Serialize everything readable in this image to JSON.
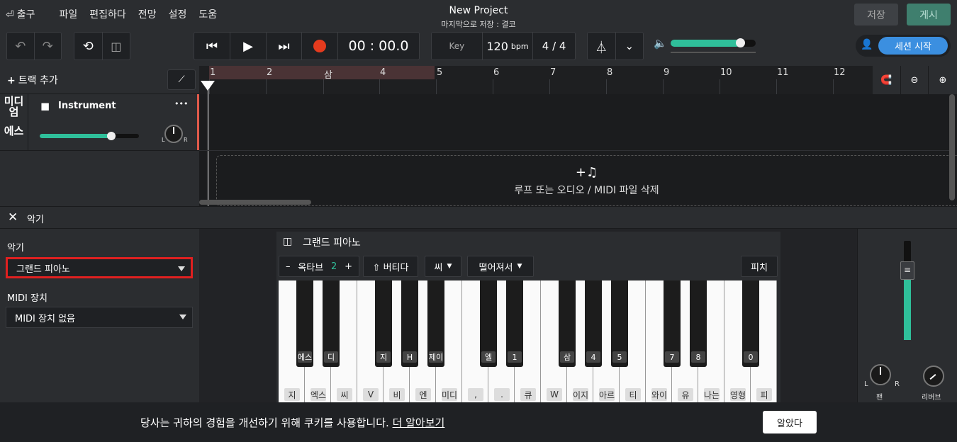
{
  "menu": {
    "exit": "출구",
    "items": [
      "파일",
      "편집하다",
      "전망",
      "설정",
      "도움"
    ]
  },
  "project": {
    "title": "New Project",
    "last_saved": "마지막으로 저장 : 결코"
  },
  "header": {
    "save": "저장",
    "publish": "게시"
  },
  "transport": {
    "time": "00 : 00.0",
    "key": "Key",
    "bpm_value": "120",
    "bpm_unit": "bpm",
    "signature": "4 / 4",
    "volume": 0.82
  },
  "session": {
    "start": "세션 시작"
  },
  "tracks": {
    "add": "트랙 추가",
    "items": [
      {
        "type_line1": "미디",
        "type_line2": "엄",
        "type_line3": "에스",
        "name": "Instrument",
        "more": "•••",
        "volume": 0.72,
        "pan_l": "L",
        "pan_r": "R"
      }
    ]
  },
  "ruler": {
    "marks": [
      "1",
      "2",
      "삼",
      "4",
      "5",
      "6",
      "7",
      "8",
      "9",
      "10",
      "11",
      "12"
    ]
  },
  "dropzone": {
    "icon": "+♫",
    "text": "루프 또는 오디오 / MIDI 파일 삭제"
  },
  "instrument_panel": {
    "title": "악기",
    "instrument_label": "악기",
    "instrument_value": "그랜드 피아노",
    "midi_label": "MIDI 장치",
    "midi_value": "MIDI 장치 없음"
  },
  "piano": {
    "title": "그랜드 피아노",
    "octave_minus": "–",
    "octave_label": "옥타브",
    "octave_value": "2",
    "octave_plus": "+",
    "sustain": "⇧ 버티다",
    "velocity": "씨",
    "sound": "떨어져서",
    "pitch": "피치",
    "black_labels": [
      "에스",
      "디",
      "지",
      "H",
      "제이",
      "엘",
      "1",
      "삼",
      "4",
      "5",
      "7",
      "8",
      "0"
    ],
    "white_labels": [
      "지",
      "엑스",
      "씨",
      "V",
      "비",
      "엔",
      "미디",
      ",",
      ".",
      "큐",
      "W",
      "이지",
      "아르",
      "티",
      "와이",
      "유",
      "나는",
      "영형",
      "피"
    ]
  },
  "mixer": {
    "pan": "팬",
    "reverb": "리버브",
    "pan_l": "L",
    "pan_r": "R",
    "level": 0.7
  },
  "cookie": {
    "text": "당사는 귀하의 경험을 개선하기 위해 쿠키를 사용합니다.",
    "link": "더 알아보기",
    "ok": "알았다"
  },
  "colors": {
    "accent": "#2fbf9a",
    "record": "#e53b1e",
    "highlight": "#e02020",
    "session": "#3b8fe0"
  }
}
